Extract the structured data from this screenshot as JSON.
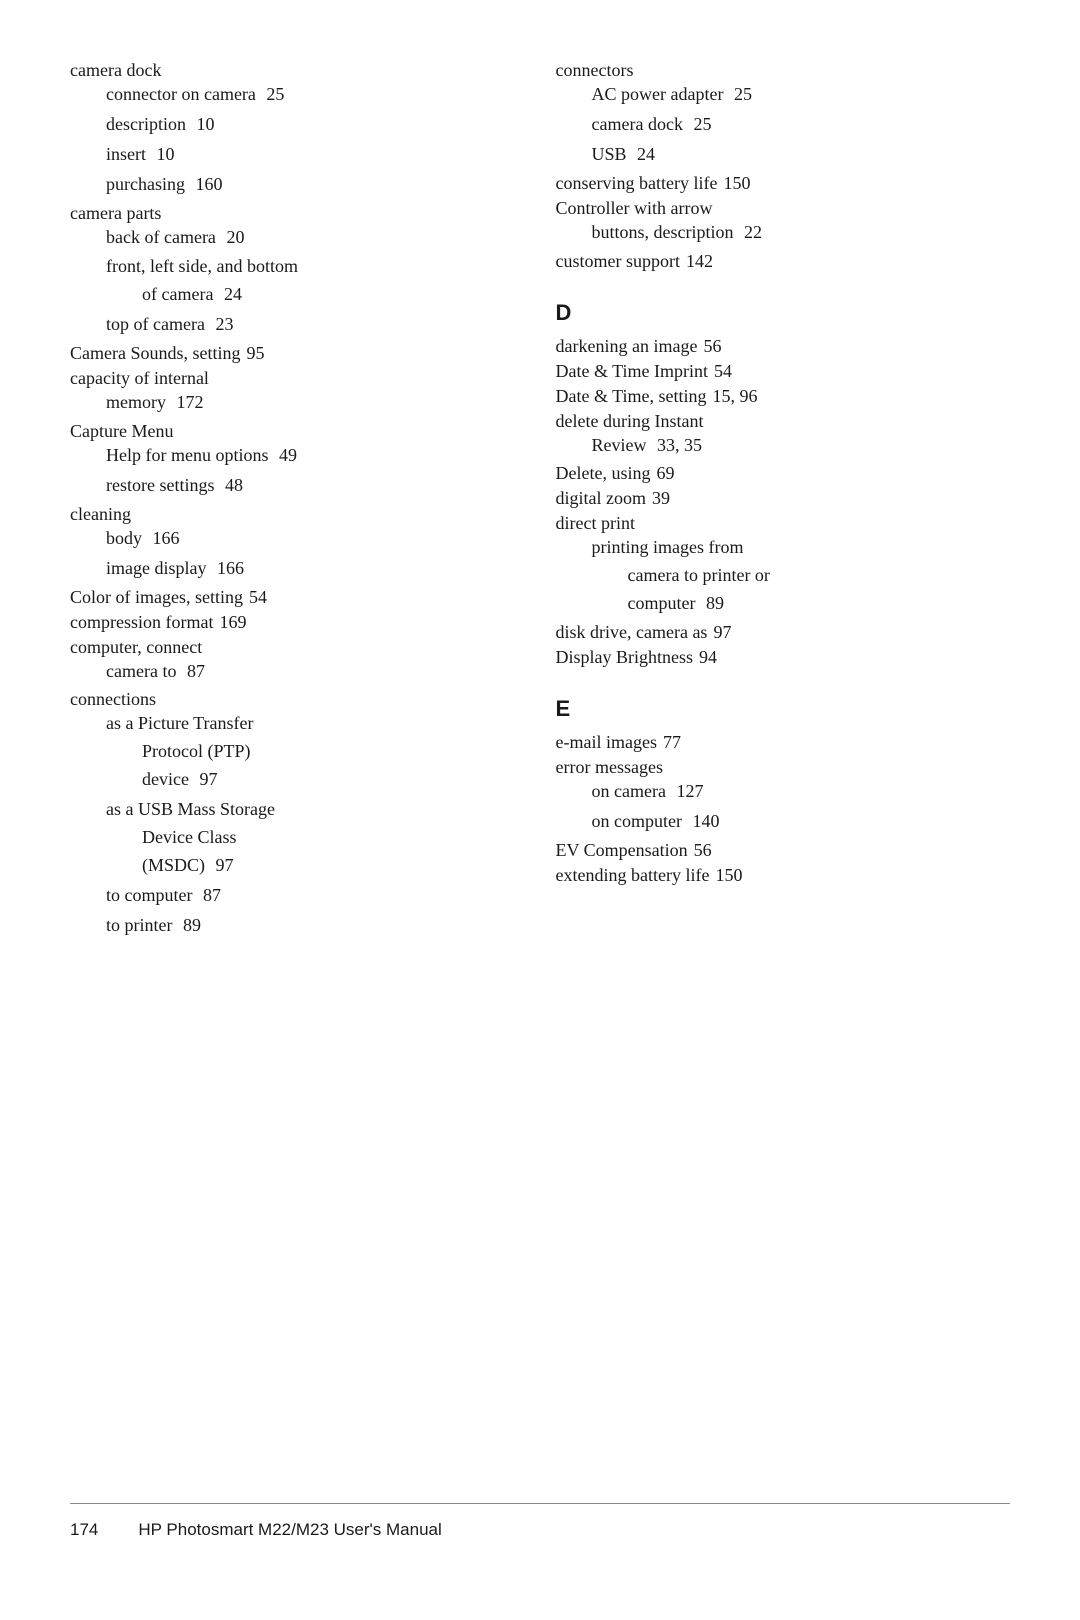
{
  "page": {
    "footer": {
      "page_number": "174",
      "title": "HP Photosmart M22/M23 User's Manual"
    }
  },
  "left_column": {
    "entries": [
      {
        "id": "camera-dock",
        "title": "camera dock",
        "sub_entries": [
          {
            "id": "connector-on-camera",
            "title": "connector on camera",
            "page": "25"
          },
          {
            "id": "description",
            "title": "description",
            "page": "10"
          },
          {
            "id": "insert",
            "title": "insert",
            "page": "10"
          },
          {
            "id": "purchasing",
            "title": "purchasing",
            "page": "160"
          }
        ]
      },
      {
        "id": "camera-parts",
        "title": "camera parts",
        "sub_entries": [
          {
            "id": "back-of-camera",
            "title": "back of camera",
            "page": "20"
          },
          {
            "id": "front-left-side",
            "title": "front, left side, and bottom",
            "title_wrap": "of camera",
            "page": "24"
          },
          {
            "id": "top-of-camera",
            "title": "top of camera",
            "page": "23"
          }
        ]
      },
      {
        "id": "camera-sounds",
        "title": "Camera Sounds, setting",
        "page": "95"
      },
      {
        "id": "capacity-internal",
        "title": "capacity of internal",
        "title_wrap": "memory",
        "page": "172"
      },
      {
        "id": "capture-menu",
        "title": "Capture Menu",
        "sub_entries": [
          {
            "id": "help-menu-options",
            "title": "Help for menu options",
            "page": "49"
          },
          {
            "id": "restore-settings",
            "title": "restore settings",
            "page": "48"
          }
        ]
      },
      {
        "id": "cleaning",
        "title": "cleaning",
        "sub_entries": [
          {
            "id": "body",
            "title": "body",
            "page": "166"
          },
          {
            "id": "image-display",
            "title": "image display",
            "page": "166"
          }
        ]
      },
      {
        "id": "color-images",
        "title": "Color of images, setting",
        "page": "54"
      },
      {
        "id": "compression-format",
        "title": "compression format",
        "page": "169"
      },
      {
        "id": "computer-connect",
        "title": "computer, connect",
        "title_wrap": "camera to",
        "page": "87"
      },
      {
        "id": "connections",
        "title": "connections",
        "sub_entries": [
          {
            "id": "picture-transfer-protocol",
            "title": "as a Picture Transfer",
            "title_wrap": "Protocol (PTP)",
            "title_wrap2": "device",
            "page": "97"
          },
          {
            "id": "usb-mass-storage",
            "title": "as a USB Mass Storage",
            "title_wrap": "Device Class",
            "title_wrap2": "(MSDC)",
            "page": "97"
          },
          {
            "id": "to-computer",
            "title": "to computer",
            "page": "87"
          },
          {
            "id": "to-printer",
            "title": "to printer",
            "page": "89"
          }
        ]
      }
    ]
  },
  "right_column": {
    "sections": [
      {
        "id": "connectors-group",
        "type": "entry",
        "title": "connectors",
        "sub_entries": [
          {
            "id": "ac-power-adapter",
            "title": "AC power adapter",
            "page": "25"
          },
          {
            "id": "camera-dock-conn",
            "title": "camera dock",
            "page": "25"
          },
          {
            "id": "usb",
            "title": "USB",
            "page": "24"
          }
        ]
      },
      {
        "id": "conserving-battery",
        "type": "entry",
        "title": "conserving battery life",
        "page": "150"
      },
      {
        "id": "controller-arrow",
        "type": "entry",
        "title": "Controller with arrow",
        "title_wrap": "buttons, description",
        "page": "22"
      },
      {
        "id": "customer-support",
        "type": "entry",
        "title": "customer support",
        "page": "142"
      },
      {
        "id": "section-d",
        "type": "section",
        "label": "D"
      },
      {
        "id": "darkening-image",
        "type": "entry",
        "title": "darkening an image",
        "page": "56"
      },
      {
        "id": "date-time-imprint",
        "type": "entry",
        "title": "Date & Time Imprint",
        "page": "54"
      },
      {
        "id": "date-time-setting",
        "type": "entry",
        "title": "Date & Time, setting",
        "page": "15,  96"
      },
      {
        "id": "delete-during-instant",
        "type": "entry",
        "title": "delete during Instant",
        "title_wrap": "Review",
        "page": "33,  35"
      },
      {
        "id": "delete-using",
        "type": "entry",
        "title": "Delete, using",
        "page": "69"
      },
      {
        "id": "digital-zoom",
        "type": "entry",
        "title": "digital zoom",
        "page": "39"
      },
      {
        "id": "direct-print",
        "type": "entry",
        "title": "direct print",
        "sub_entries": [
          {
            "id": "printing-images-from",
            "title": "printing images from",
            "title_wrap": "camera to printer or",
            "title_wrap2": "computer",
            "page": "89"
          }
        ]
      },
      {
        "id": "disk-drive-camera",
        "type": "entry",
        "title": "disk drive, camera as",
        "page": "97"
      },
      {
        "id": "display-brightness",
        "type": "entry",
        "title": "Display Brightness",
        "page": "94"
      },
      {
        "id": "section-e",
        "type": "section",
        "label": "E"
      },
      {
        "id": "email-images",
        "type": "entry",
        "title": "e-mail images",
        "page": "77"
      },
      {
        "id": "error-messages",
        "type": "entry",
        "title": "error messages",
        "sub_entries": [
          {
            "id": "on-camera",
            "title": "on camera",
            "page": "127"
          },
          {
            "id": "on-computer",
            "title": "on computer",
            "page": "140"
          }
        ]
      },
      {
        "id": "ev-compensation",
        "type": "entry",
        "title": "EV Compensation",
        "page": "56"
      },
      {
        "id": "extending-battery",
        "type": "entry",
        "title": "extending battery life",
        "page": "150"
      }
    ]
  }
}
